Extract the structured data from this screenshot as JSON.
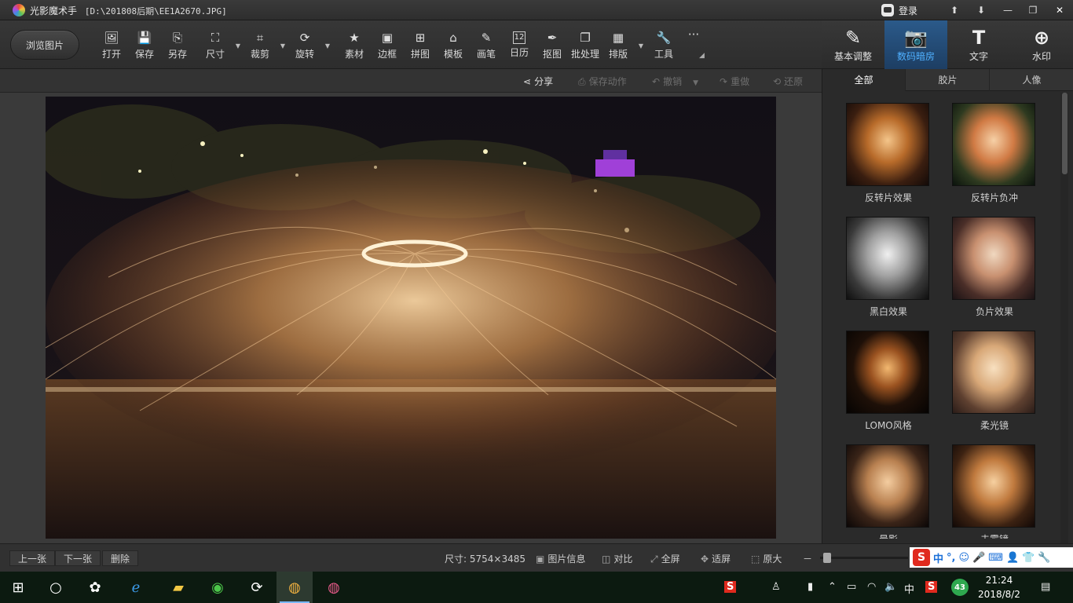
{
  "app": {
    "title": "光影魔术手",
    "path": "[D:\\201808后期\\EE1A2670.JPG]",
    "login_label": "登录"
  },
  "window_controls": [
    "⬆",
    "⬇",
    "—",
    "❐",
    "✕"
  ],
  "toolbar": {
    "browse_label": "浏览图片",
    "tools": [
      {
        "label": "打开",
        "icon": "image-open-icon"
      },
      {
        "label": "保存",
        "icon": "save-icon"
      },
      {
        "label": "另存",
        "icon": "save-as-icon"
      },
      {
        "label": "尺寸",
        "icon": "resize-icon"
      },
      {
        "label": "裁剪",
        "icon": "crop-icon"
      },
      {
        "label": "旋转",
        "icon": "rotate-icon"
      },
      {
        "label": "素材",
        "icon": "material-icon"
      },
      {
        "label": "边框",
        "icon": "frame-icon"
      },
      {
        "label": "拼图",
        "icon": "collage-icon"
      },
      {
        "label": "模板",
        "icon": "template-icon"
      },
      {
        "label": "画笔",
        "icon": "brush-icon"
      },
      {
        "label": "日历",
        "icon": "calendar-icon"
      },
      {
        "label": "抠图",
        "icon": "cutout-icon"
      },
      {
        "label": "批处理",
        "icon": "batch-icon"
      },
      {
        "label": "排版",
        "icon": "layout-icon"
      },
      {
        "label": "工具",
        "icon": "wrench-icon"
      }
    ],
    "more_label": "···",
    "calendar_day": "12"
  },
  "right_tabs": [
    {
      "label": "基本调整",
      "icon": "adjust-icon"
    },
    {
      "label": "数码暗房",
      "icon": "camera-icon"
    },
    {
      "label": "文字",
      "icon": "text-icon"
    },
    {
      "label": "水印",
      "icon": "watermark-icon"
    }
  ],
  "actions": {
    "share": "分享",
    "save_action": "保存动作",
    "undo": "撤销",
    "redo": "重做",
    "restore": "还原"
  },
  "filter_tabs": [
    "全部",
    "胶片",
    "人像"
  ],
  "filters": [
    {
      "label": "反转片效果"
    },
    {
      "label": "反转片负冲"
    },
    {
      "label": "黑白效果"
    },
    {
      "label": "负片效果"
    },
    {
      "label": "LOMO风格"
    },
    {
      "label": "柔光镜"
    },
    {
      "label": "晕影"
    },
    {
      "label": "去雾镜"
    }
  ],
  "status": {
    "prev": "上一张",
    "next": "下一张",
    "delete": "删除",
    "size": "尺寸: 5754×3485",
    "info": "图片信息",
    "compare": "对比",
    "fullscreen": "全屏",
    "fit": "适屏",
    "original": "原大",
    "zoom_minus": "－",
    "zoom_fraction": 0.02
  },
  "ime": {
    "lang": "中"
  },
  "taskbar": {
    "time": "21:24",
    "date": "2018/8/2",
    "tray_lang": "中",
    "badge": "43"
  }
}
